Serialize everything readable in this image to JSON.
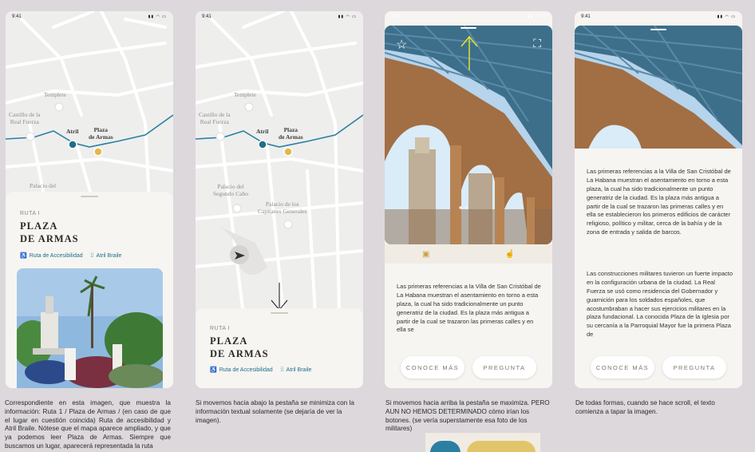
{
  "status": {
    "time": "9:41",
    "icons": "▮▮ ◠ ▭"
  },
  "map": {
    "templete": "Templete",
    "castillo": "Castillo de la\nReal Fuerza",
    "atril": "Atril",
    "plaza": "Plaza\nde Armas",
    "palacio_del": "Palacio del",
    "palacio_segundo": "Palacio del\nSegundo Cabo",
    "palacio_capitanes": "Palacio de los\nCapitanes Generales"
  },
  "sheet": {
    "ruta": "RUTA I",
    "place_line1": "PLAZA",
    "place_line2": "DE ARMAS",
    "link_accesibilidad": "Ruta de Accesibilidad",
    "link_braile": "Atril Braile"
  },
  "detail": {
    "text1": "Las primeras referencias a la Villa de San Cristóbal de La Habana muestran el asentamiento en torno a esta plaza, la cual ha sido tradicionalmente un punto generatriz de la ciudad. Es la plaza más antigua a partir de la cual se trazaron las primeras calles y en ella se",
    "text_full": "Las primeras referencias a la Villa de San Cristóbal de La Habana muestran el asentamiento en torno a esta plaza, la cual ha sido tradicionalmente un punto generatriz de la ciudad. Es la plaza más antigua a partir de la cual se trazaron las primeras calles y en ella se establecieron los primeros edificios de carácter religioso, político y militar, cerca de la bahía y de la zona de entrada y salida de barcos.",
    "text_second": "Las construcciones militares tuvieron un fuerte impacto en la configuración urbana de la ciudad. La Real Fuerza se usó como residencia del Gobernador y guarnición para los soldados españoles, que acostumbraban a hacer sus ejercicios militares en la plaza fundacional. La conocida Plaza de la Iglesia por su cercanía a la Parroquial Mayor fue la primera Plaza de",
    "btn_conoce": "CONOCE MÁS",
    "btn_pregunta": "PREGUNTA"
  },
  "captions": {
    "c1": "Correspondiente en esta imagen, que muestra la información: Ruta 1 / Plaza de Armas / (en caso de que el lugar en cuestión coincida) Ruta de accesibilidad y Atril Braile. Nótese que el mapa aparece ampliado, y que ya podemos leer Plaza de Armas. Siempre que buscamos un lugar, aparecerá representada la ruta",
    "c2": "Si movemos hacia abajo la pestaña se minimiza con la información textual solamente (se dejaría de ver la imagen).",
    "c3": "Si movemos hacia arriba la pestaña se maximiza. PERO AUN NO HEMOS DETERMINADO cómo irían los botones. (se vería superstamente esa foto de los militares)",
    "c4": "De todas formas, cuando se hace scroll, el texto comienza a tapar la imagen."
  },
  "colors": {
    "route": "#2b7fa3",
    "link": "#1c6f8c",
    "plaza_pin": "#e2b84c",
    "atril_pin": "#1f6f8a",
    "annotation": "#e8e82a"
  }
}
